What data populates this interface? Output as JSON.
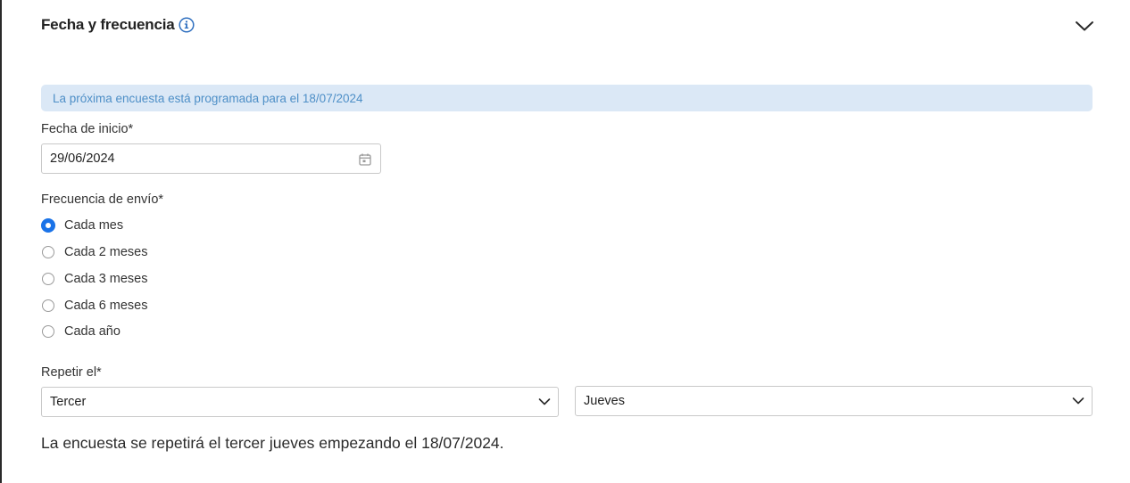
{
  "section": {
    "title": "Fecha y frecuencia",
    "info_icon": "info-circle-icon",
    "toggle_icon": "chevron-down-icon"
  },
  "banner": {
    "text": "La próxima encuesta está programada para el 18/07/2024"
  },
  "start_date": {
    "label": "Fecha de inicio*",
    "value": "29/06/2024",
    "icon": "calendar-icon"
  },
  "frequency": {
    "label": "Frecuencia de envío*",
    "options": [
      {
        "label": "Cada mes",
        "checked": true
      },
      {
        "label": "Cada 2 meses",
        "checked": false
      },
      {
        "label": "Cada 3 meses",
        "checked": false
      },
      {
        "label": "Cada 6 meses",
        "checked": false
      },
      {
        "label": "Cada año",
        "checked": false
      }
    ]
  },
  "repeat": {
    "label": "Repetir el*",
    "ordinal_value": "Tercer",
    "weekday_value": "Jueves"
  },
  "summary": {
    "text": "La encuesta se repetirá el tercer jueves empezando el 18/07/2024."
  },
  "colors": {
    "accent": "#1a73e8",
    "banner_bg": "#dbe8f6",
    "banner_text": "#4e8fc7",
    "border": "#c9c9c9"
  }
}
